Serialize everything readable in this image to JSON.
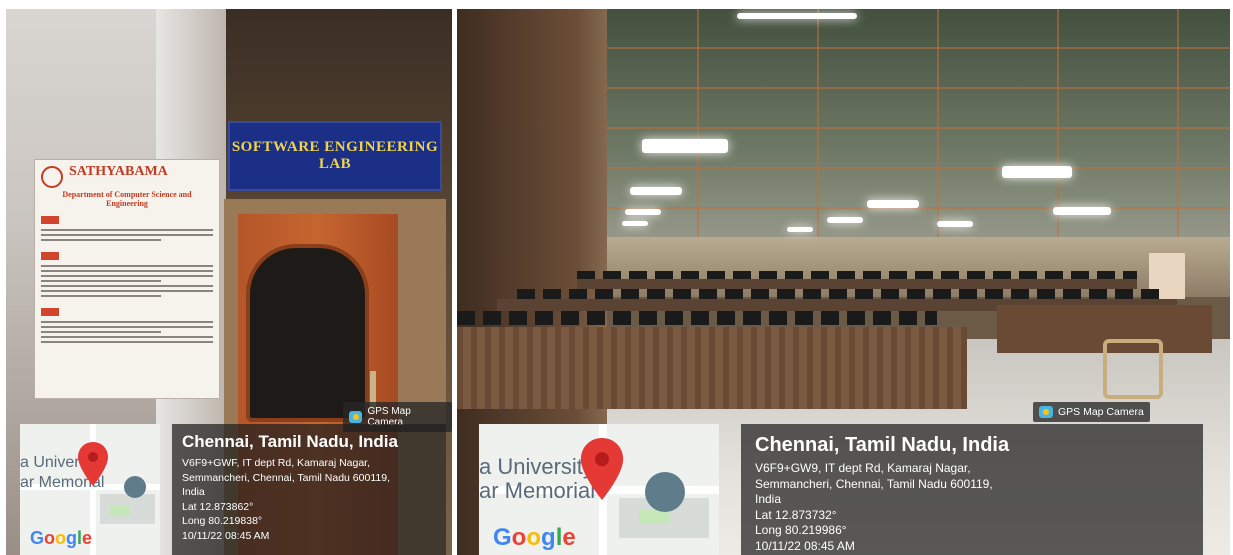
{
  "left_photo": {
    "sign_text": "SOFTWARE ENGINEERING LAB",
    "poster": {
      "brand": "SATHYABAMA",
      "department": "Department of Computer Science and Engineering"
    },
    "gps_badge": "GPS Map Camera",
    "map": {
      "label_line1": "a University",
      "label_line2": "ar Memorial",
      "google": [
        "G",
        "o",
        "o",
        "g",
        "l",
        "e"
      ]
    },
    "location": {
      "city": "Chennai, Tamil Nadu, India",
      "address1": "V6F9+GWF, IT dept Rd, Kamaraj Nagar,",
      "address2": "Semmancheri, Chennai, Tamil Nadu 600119,",
      "address3": "India",
      "lat": "Lat 12.873862°",
      "long": "Long 80.219838°",
      "datetime": "10/11/22 08:45 AM"
    }
  },
  "right_photo": {
    "gps_badge": "GPS Map Camera",
    "map": {
      "label_line1": "a University",
      "label_line2": "ar Memorial"
    },
    "location": {
      "city": "Chennai, Tamil Nadu, India",
      "address1": "V6F9+GW9, IT dept Rd, Kamaraj Nagar,",
      "address2": "Semmancheri, Chennai, Tamil Nadu 600119,",
      "address3": "India",
      "lat": "Lat 12.873732°",
      "long": "Long 80.219986°",
      "datetime": "10/11/22 08:45 AM"
    }
  },
  "colors": {
    "sign_bg": "#1b2f86",
    "sign_text": "#f0d44a",
    "pin": "#e53935",
    "overlay": "rgba(30,30,30,0.72)",
    "brand_red": "#c23b22"
  }
}
